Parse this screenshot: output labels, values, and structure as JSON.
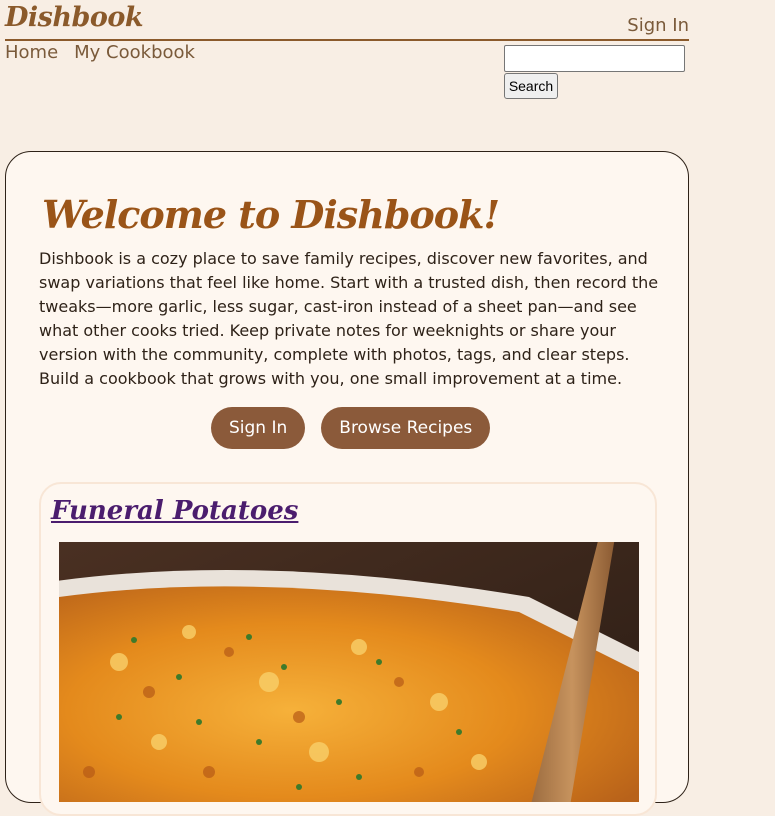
{
  "header": {
    "logo": "Dishbook",
    "sign_in": "Sign In",
    "nav": [
      "Home",
      "My Cookbook"
    ]
  },
  "search": {
    "placeholder": "",
    "value": "",
    "button": "Search"
  },
  "welcome": {
    "title": "Welcome to Dishbook!",
    "intro": "Dishbook is a cozy place to save family recipes, discover new favorites, and swap variations that feel like home. Start with a trusted dish, then record the tweaks—more garlic, less sugar, cast-iron instead of a sheet pan—and see what other cooks tried. Keep private notes for weeknights or share your version with the community, complete with photos, tags, and clear steps. Build a cookbook that grows with you, one small improvement at a time.",
    "buttons": {
      "sign_in": "Sign In",
      "browse": "Browse Recipes"
    }
  },
  "recipe": {
    "title": "Funeral Potatoes"
  },
  "colors": {
    "accent": "#8b5a2b",
    "button": "#8b5a3a",
    "link": "#4b1d6e",
    "background": "#f8eee4",
    "card": "#fef7f0"
  }
}
